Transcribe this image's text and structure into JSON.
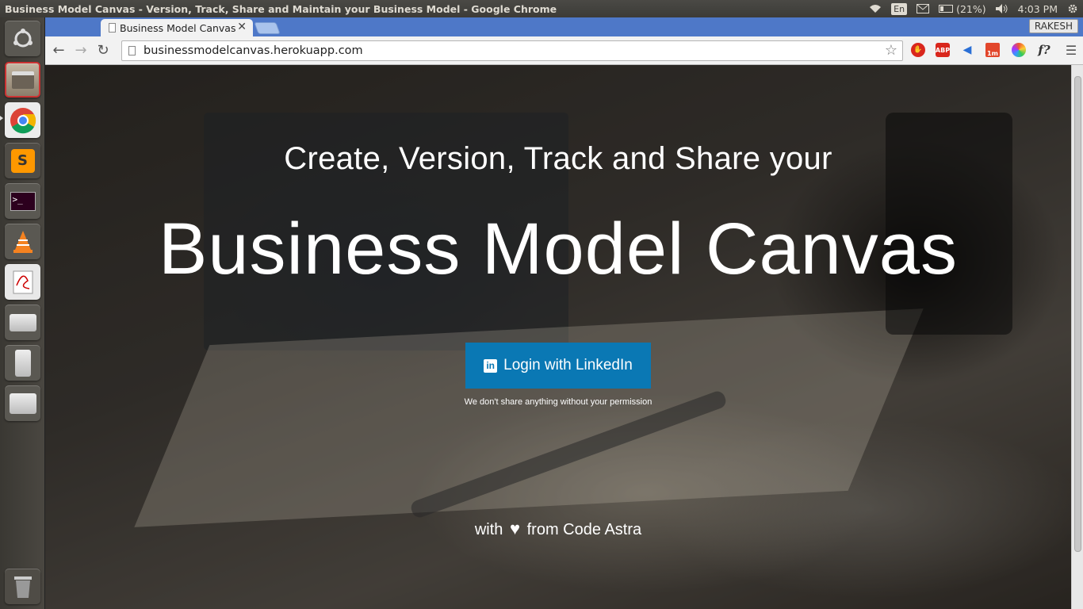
{
  "system": {
    "window_title": "Business Model Canvas - Version, Track, Share and Maintain your Business Model - Google Chrome",
    "tray": {
      "language": "En",
      "battery": "(21%)",
      "clock": "4:03 PM"
    }
  },
  "launcher": {
    "items": [
      {
        "name": "ubuntu-home-icon"
      },
      {
        "name": "files-icon"
      },
      {
        "name": "chrome-icon"
      },
      {
        "name": "sublime-text-icon"
      },
      {
        "name": "terminal-icon"
      },
      {
        "name": "vlc-icon"
      },
      {
        "name": "document-viewer-icon"
      },
      {
        "name": "drive-icon"
      },
      {
        "name": "usb-drive-icon"
      },
      {
        "name": "usb-drive-2-icon"
      },
      {
        "name": "trash-icon"
      }
    ]
  },
  "browser": {
    "tab_title": "Business Model Canvas",
    "profile_name": "RAKESH",
    "url": "businessmodelcanvas.herokuapp.com",
    "extensions": [
      {
        "name": "stop-ext-icon",
        "color": "#d9261c"
      },
      {
        "name": "adblock-plus-icon",
        "color": "#d9261c",
        "label": "ABP"
      },
      {
        "name": "megaphone-ext-icon",
        "color": "#2a6fd6"
      },
      {
        "name": "1m-ext-icon",
        "color": "#e2462b",
        "label": "1m"
      },
      {
        "name": "color-wheel-ext-icon",
        "color": "#e59a1f"
      },
      {
        "name": "font-ext-icon",
        "color": "#333333",
        "label": "f?"
      },
      {
        "name": "chrome-menu-icon",
        "color": "#555555"
      }
    ]
  },
  "page": {
    "tagline": "Create, Version, Track and Share your",
    "headline": "Business Model Canvas",
    "login_button": "Login with LinkedIn",
    "privacy_note": "We don't share anything without your permission",
    "footer_prefix": "with",
    "footer_suffix": "from Code Astra",
    "colors": {
      "linkedin_blue": "#0a78b4",
      "tab_strip": "#4e78c8"
    }
  }
}
